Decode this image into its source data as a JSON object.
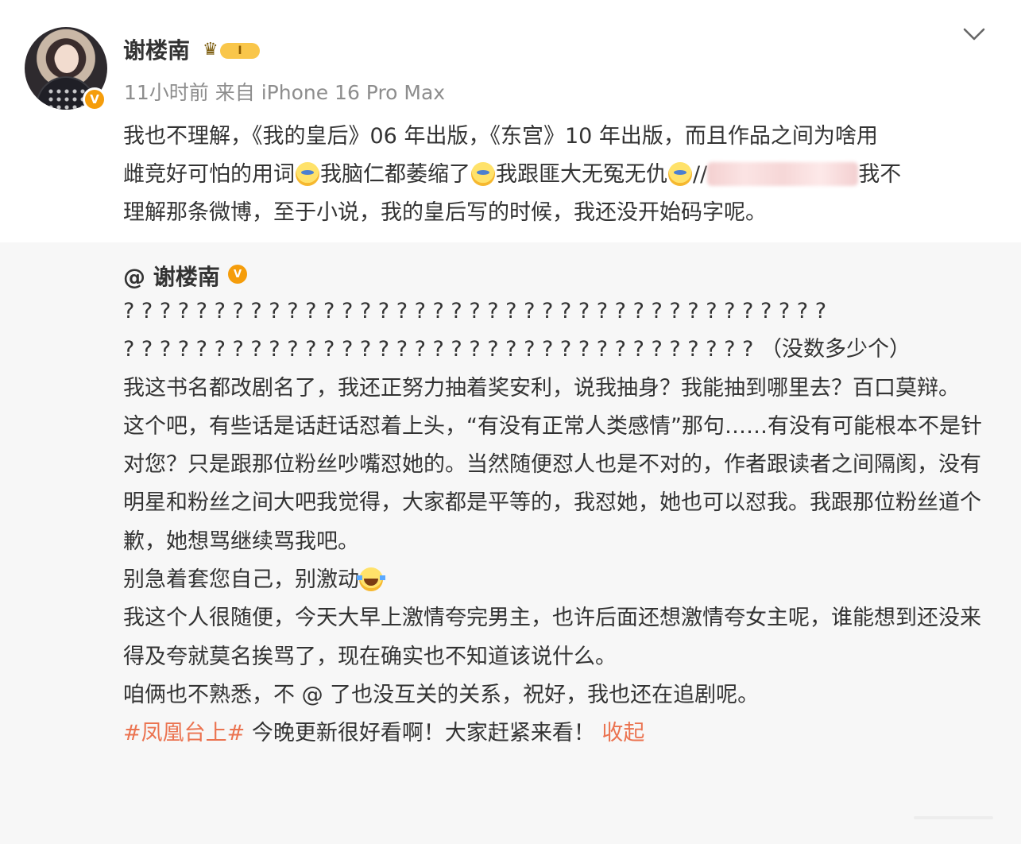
{
  "user": {
    "name": "谢楼南",
    "level": "I"
  },
  "meta": {
    "time": "11小时前",
    "source": "来自 iPhone 16 Pro Max"
  },
  "post": {
    "line1": "我也不理解，《我的皇后》06 年出版，《东宫》10 年出版，而且作品之间为啥用",
    "line2a": "雌竞好可怕的用词",
    "line2b": "我脑仁都萎缩了",
    "line2c": "我跟匪大无冤无仇",
    "line2d": "//",
    "line2e": "我不",
    "line3": "理解那条微博，至于小说，我的皇后写的时候，我还没开始码字呢。"
  },
  "repost": {
    "author": "@ 谢楼南",
    "q1": "? ? ? ? ? ? ? ? ? ? ? ? ? ? ? ? ? ? ? ? ? ? ? ? ? ? ? ? ? ? ? ? ? ? ? ? ? ? ?",
    "q2": "? ? ? ? ? ? ? ? ? ? ? ? ? ? ? ? ? ? ? ? ? ? ? ? ? ? ? ? ? ? ? ? ? ? ?  （没数多少个）",
    "p1": "我这书名都改剧名了，我还正努力抽着奖安利，说我抽身？我能抽到哪里去？百口莫辩。",
    "p2": "这个吧，有些话是话赶话怼着上头，“有没有正常人类感情”那句……有没有可能根本不是针对您？只是跟那位粉丝吵嘴怼她的。当然随便怼人也是不对的，作者跟读者之间隔阂，没有明星和粉丝之间大吧我觉得，大家都是平等的，我怼她，她也可以怼我。我跟那位粉丝道个歉，她想骂继续骂我吧。",
    "p3": "别急着套您自己，别激动",
    "p4": "我这个人很随便，今天大早上激情夸完男主，也许后面还想激情夸女主呢，谁能想到还没来得及夸就莫名挨骂了，现在确实也不知道该说什么。",
    "p5": "咱俩也不熟悉，不 @ 了也没互关的关系，祝好，我也还在追剧呢。",
    "hashtag": "#凤凰台上#",
    "p6": " 今晚更新很好看啊！大家赶紧来看！ ",
    "collapse": "收起"
  },
  "icons": {
    "collapse": "chevron-down-icon",
    "verified": "verified-v-icon",
    "crown": "crown-icon"
  },
  "colors": {
    "accent": "#eb7350",
    "verified": "#f59d0b",
    "meta": "#8d8d8d"
  }
}
